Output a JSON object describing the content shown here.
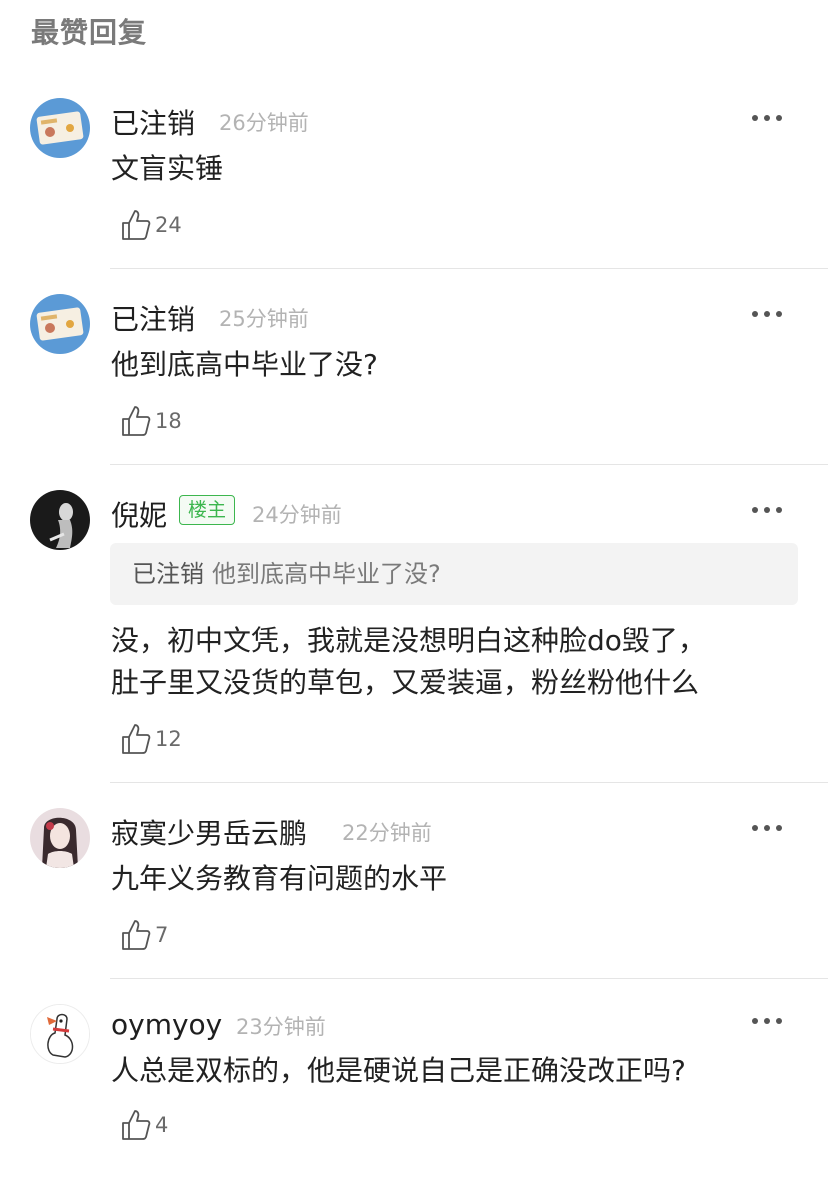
{
  "header": {
    "title": "最赞回复"
  },
  "comments": [
    {
      "name": "已注销",
      "time": "26分钟前",
      "text": "文盲实锤",
      "likes": "24",
      "avatar_icon": "card-avatar-icon"
    },
    {
      "name": "已注销",
      "time": "25分钟前",
      "text": "他到底高中毕业了没?",
      "likes": "18",
      "avatar_icon": "card-avatar-icon"
    },
    {
      "name": "倪妮",
      "badge": "楼主",
      "time": "24分钟前",
      "quote": {
        "name": "已注销",
        "text": "他到底高中毕业了没?"
      },
      "text_lines": [
        "没，初中文凭，我就是没想明白这种脸do毁了，",
        "肚子里又没货的草包，又爱装逼，粉丝粉他什么"
      ],
      "likes": "12",
      "avatar_icon": "dark-portrait-avatar-icon"
    },
    {
      "name": "寂寞少男岳云鹏",
      "time": "22分钟前",
      "text": "九年义务教育有问题的水平",
      "likes": "7",
      "avatar_icon": "portrait-avatar-icon"
    },
    {
      "name": "oymyoy",
      "time": "23分钟前",
      "text": "人总是双标的，他是硬说自己是正确没改正吗?",
      "likes": "4",
      "avatar_icon": "duck-avatar-icon"
    }
  ],
  "colors": {
    "badge": "#3cb64e",
    "time": "#b3b3b3",
    "quote_bg": "#f3f3f3"
  }
}
